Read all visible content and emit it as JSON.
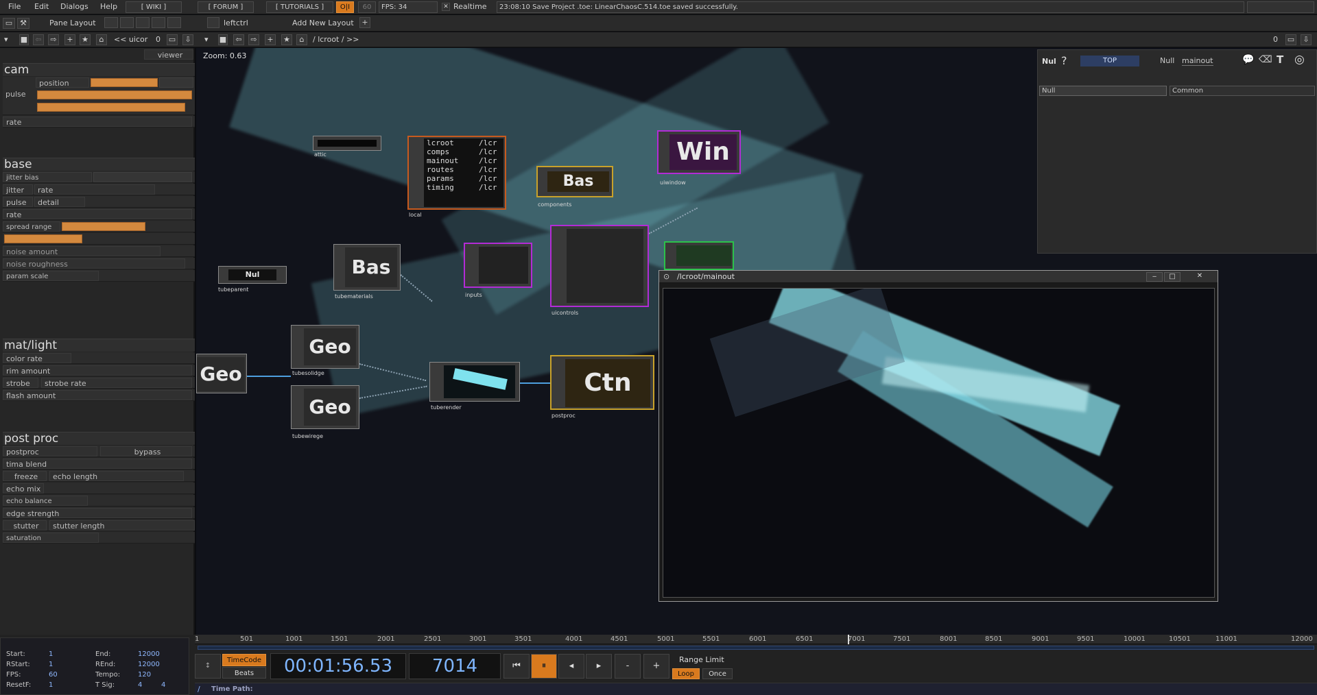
{
  "menu": {
    "file": "File",
    "edit": "Edit",
    "dialogs": "Dialogs",
    "help": "Help",
    "wiki": "[ WIKI ]",
    "forum": "[ FORUM ]",
    "tutorials": "[ TUTORIALS ]",
    "perf": "O|I",
    "fps_cap": "60",
    "fps": "FPS: 34",
    "realtime": "Realtime",
    "status": "23:08:10 Save Project .toe: LinearChaosC.514.toe saved successfully."
  },
  "toolbar": {
    "pane_layout": "Pane Layout",
    "leftctrl": "leftctrl",
    "add_layout": "Add New Layout",
    "plus": "+",
    "path_left": "<< uicor",
    "zero": "0",
    "path_right": "/ lcroot / >>"
  },
  "left": {
    "viewer": "viewer",
    "cam": "cam",
    "position": "position",
    "pulse": "pulse",
    "rate": "rate",
    "base": "base",
    "jitter_bias": "jitter bias",
    "jitter": "jitter",
    "jitter_rate": "rate",
    "pulse2": "pulse",
    "detail": "detail",
    "rate2": "rate",
    "spread_range": "spread range",
    "noise_amount": "noise amount",
    "noise_roughness": "noise roughness",
    "param_scale": "param scale",
    "matlight": "mat/light",
    "color_rate": "color rate",
    "rim_amount": "rim amount",
    "strobe": "strobe",
    "strobe_rate": "strobe rate",
    "flash_amount": "flash amount",
    "postproc_head": "post proc",
    "postproc": "postproc",
    "bypass": "bypass",
    "tima_blend": "tima blend",
    "freeze": "freeze",
    "echo_length": "echo length",
    "echo_mix": "echo mix",
    "echo_balance": "echo balance",
    "edge_strength": "edge strength",
    "stutter": "stutter",
    "stutter_length": "stutter length",
    "saturation": "saturation"
  },
  "network": {
    "zoom": "Zoom: 0.63",
    "attic": "attic",
    "local": "local",
    "local_rows": [
      [
        "lcroot",
        "/lcr"
      ],
      [
        "comps",
        "/lcr"
      ],
      [
        "mainout",
        "/lcr"
      ],
      [
        "routes",
        "/lcr"
      ],
      [
        "params",
        "/lcr"
      ],
      [
        "timing",
        "/lcr"
      ]
    ],
    "bas1": "Bas",
    "components": "components",
    "win": "Win",
    "uiwindow": "uiwindow",
    "nul": "Nul",
    "tubeparent": "tubeparent",
    "bas2": "Bas",
    "tubematerials": "tubematerials",
    "inputs": "inputs",
    "uicontrols": "uicontrols",
    "geo_left": "Geo",
    "geo1": "Geo",
    "tubesolidge": "tubesolidge",
    "geo2": "Geo",
    "tubewirege": "tubewirege",
    "tuberender": "tuberender",
    "ctn": "Ctn",
    "postproc": "postproc"
  },
  "param_panel": {
    "nul": "Nul",
    "help": "?",
    "family": "TOP",
    "type": "Null",
    "name": "mainout",
    "tab1": "Null",
    "tab2": "Common"
  },
  "viewer": {
    "title": "/lcroot/mainout",
    "min": "‒",
    "max": "□",
    "close": "✕"
  },
  "timeline": {
    "ticks": [
      "1",
      "501",
      "1001",
      "1501",
      "2001",
      "2501",
      "3001",
      "3501",
      "4001",
      "4501",
      "5001",
      "5501",
      "6001",
      "6501",
      "7001",
      "7501",
      "8001",
      "8501",
      "9001",
      "9501",
      "10001",
      "10501",
      "11001",
      "12000"
    ],
    "start_k": "Start:",
    "start_v": "1",
    "end_k": "End:",
    "end_v": "12000",
    "rstart_k": "RStart:",
    "rstart_v": "1",
    "rend_k": "REnd:",
    "rend_v": "12000",
    "fps_k": "FPS:",
    "fps_v": "60",
    "tempo_k": "Tempo:",
    "tempo_v": "120",
    "resetf_k": "ResetF:",
    "resetf_v": "1",
    "tsig_k": "T Sig:",
    "tsig_v1": "4",
    "tsig_v2": "4",
    "timecode": "TimeCode",
    "beats": "Beats",
    "time": "00:01:56.53",
    "frame": "7014",
    "range_limit": "Range Limit",
    "loop": "Loop",
    "once": "Once",
    "time_path": "Time Path:",
    "minus": "-",
    "plus": "+"
  },
  "colors": {
    "accent": "#d4893e",
    "viewer_cyan": "#8ce6f0",
    "node_purple": "#b32bd6",
    "node_gold": "#c9a22a",
    "node_green": "#2bc24a",
    "node_orange": "#c85a1e"
  }
}
